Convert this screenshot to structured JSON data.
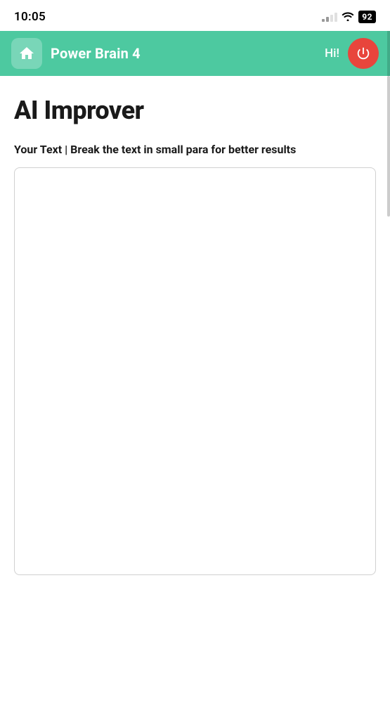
{
  "statusBar": {
    "time": "10:05",
    "battery": "92"
  },
  "header": {
    "title": "Power Brain 4",
    "greeting": "Hi!",
    "homeIconAlt": "home",
    "powerIconAlt": "power"
  },
  "main": {
    "pageTitle": "AI Improver",
    "inputLabel": "Your Text | Break the text in small para for better results",
    "textareaPlaceholder": ""
  }
}
